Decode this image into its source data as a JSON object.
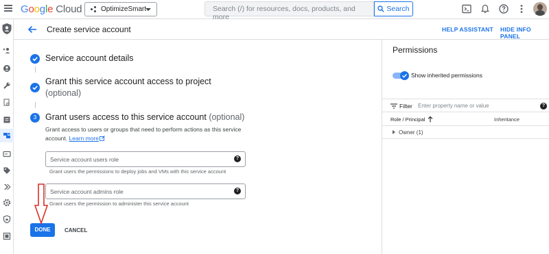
{
  "topbar": {
    "logo": "Google Cloud",
    "project": "OptimizeSmart",
    "search_placeholder": "Search (/) for resources, docs, products, and more",
    "search_button": "Search",
    "icons": [
      "menu-icon",
      "cloud-shell-icon",
      "notifications-icon",
      "help-icon",
      "more-vert-icon"
    ]
  },
  "rail": {
    "icons": [
      "shield-icon",
      "person-add-icon",
      "account-circle-icon",
      "wrench-icon",
      "document-search-icon",
      "list-icon",
      "service-account-icon",
      "card-icon",
      "tag-icon",
      "chevrons-icon",
      "gear-icon",
      "lock-shield-icon",
      "grid-icon"
    ]
  },
  "header": {
    "title": "Create service account",
    "help_assistant": "HELP ASSISTANT",
    "hide_info_panel": "HIDE INFO PANEL"
  },
  "steps": {
    "step1": {
      "title": "Service account details"
    },
    "step2": {
      "title": "Grant this service account access to project",
      "optional": "(optional)"
    },
    "step3": {
      "number": "3",
      "title": "Grant users access to this service account",
      "optional": "(optional)",
      "description": "Grant access to users or groups that need to perform actions as this service account.",
      "learn_more": "Learn more"
    }
  },
  "fields": {
    "users_role": {
      "placeholder": "Service account users role",
      "hint": "Grant users the permissions to deploy jobs and VMs with this service account"
    },
    "admins_role": {
      "placeholder": "Service account admins role",
      "hint": "Grant users the permission to administer this service account"
    }
  },
  "actions": {
    "done": "DONE",
    "cancel": "CANCEL"
  },
  "panel": {
    "title": "Permissions",
    "toggle_label": "Show inherited permissions",
    "toggle_on": true,
    "filter_label": "Filter",
    "filter_placeholder": "Enter property name or value",
    "col_role": "Role / Principal",
    "col_inheritance": "Inheritance",
    "owner_row": "Owner (1)"
  },
  "colors": {
    "accent": "#1a73e8",
    "annotation_arrow": "#d93025"
  }
}
